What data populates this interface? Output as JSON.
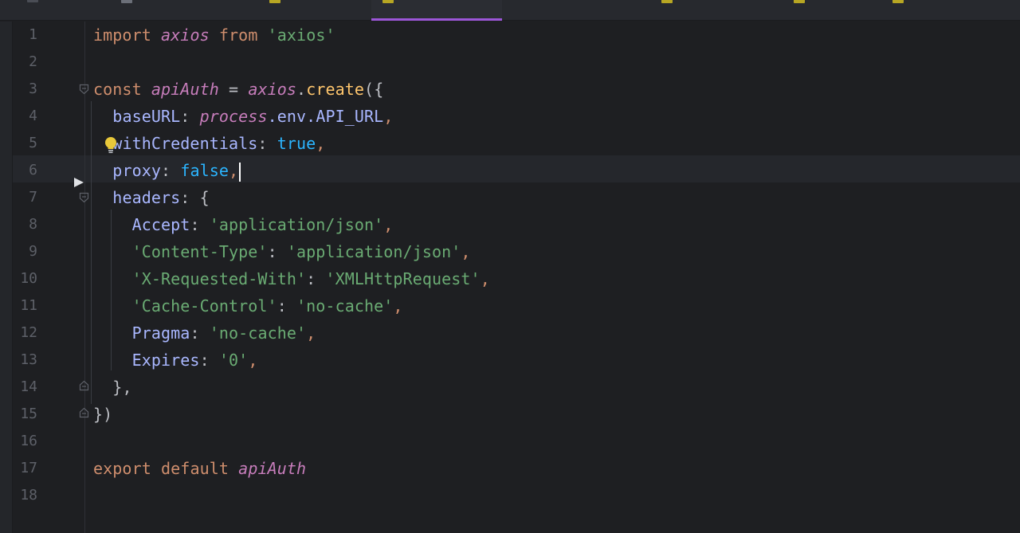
{
  "editor": {
    "line_numbers": [
      "1",
      "2",
      "3",
      "4",
      "5",
      "6",
      "7",
      "8",
      "9",
      "10",
      "11",
      "12",
      "13",
      "14",
      "15",
      "16",
      "17",
      "18"
    ],
    "current_line": "6",
    "code": {
      "l1_import": "import",
      "l1_axios": "axios",
      "l1_from": "from",
      "l1_str": "'axios'",
      "l3_const": "const",
      "l3_name": "apiAuth",
      "l3_eq": " = ",
      "l3_axios": "axios",
      "l3_dot": ".",
      "l3_create": "create",
      "l3_open": "({",
      "l4_key": "baseURL",
      "l4_colon": ": ",
      "l4_process": "process",
      "l4_rest": ".env.",
      "l4_const": "API_URL",
      "l4_comma": ",",
      "l5_key": "withCredentials",
      "l5_colon": ": ",
      "l5_val": "true",
      "l5_comma": ",",
      "l6_key": "proxy",
      "l6_colon": ": ",
      "l6_val": "false",
      "l6_comma": ",",
      "l7_key": "headers",
      "l7_colon": ": ",
      "l7_open": "{",
      "l8_key": "Accept",
      "l8_colon": ": ",
      "l8_val": "'application/json'",
      "l8_comma": ",",
      "l9_key": "'Content-Type'",
      "l9_colon": ": ",
      "l9_val": "'application/json'",
      "l9_comma": ",",
      "l10_key": "'X-Requested-With'",
      "l10_colon": ": ",
      "l10_val": "'XMLHttpRequest'",
      "l10_comma": ",",
      "l11_key": "'Cache-Control'",
      "l11_colon": ": ",
      "l11_val": "'no-cache'",
      "l11_comma": ",",
      "l12_key": "Pragma",
      "l12_colon": ": ",
      "l12_val": "'no-cache'",
      "l12_comma": ",",
      "l13_key": "Expires",
      "l13_colon": ": ",
      "l13_val": "'0'",
      "l13_comma": ",",
      "l14_close": "},",
      "l15_close": "})",
      "l17_export": "export",
      "l17_default": "default",
      "l17_name": "apiAuth"
    }
  },
  "colors": {
    "background": "#1e1f22",
    "keyword": "#cf8e6d",
    "italic_identifier": "#c77dbb",
    "function": "#ffc66d",
    "property": "#a9b7ff",
    "string": "#6aab73",
    "boolean": "#2bb5ff",
    "active_tab_underline": "#9c56d8",
    "file_icon": "#b7a623"
  },
  "icons": {
    "lightbulb": "lightbulb-icon",
    "run_marker": "run-arrow-icon",
    "fold": "fold-marker-icon",
    "file": "js-file-icon"
  }
}
